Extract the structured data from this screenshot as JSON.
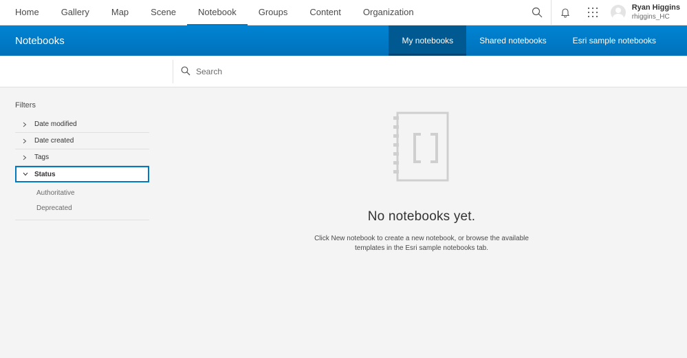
{
  "topnav": {
    "links": [
      {
        "label": "Home"
      },
      {
        "label": "Gallery"
      },
      {
        "label": "Map"
      },
      {
        "label": "Scene"
      },
      {
        "label": "Notebook"
      },
      {
        "label": "Groups"
      },
      {
        "label": "Content"
      },
      {
        "label": "Organization"
      }
    ],
    "active": "Notebook",
    "icons": [
      "search-icon",
      "bell-icon",
      "app-launcher-icon"
    ],
    "user": {
      "name": "Ryan Higgins",
      "username": "rhiggins_HC"
    }
  },
  "header": {
    "title": "Notebooks",
    "tabs": [
      {
        "label": "My notebooks"
      },
      {
        "label": "Shared notebooks"
      },
      {
        "label": "Esri sample notebooks"
      }
    ],
    "active_tab": "My notebooks"
  },
  "search": {
    "placeholder": "Search"
  },
  "filters": {
    "title": "Filters",
    "items": [
      {
        "label": "Date modified"
      },
      {
        "label": "Date created"
      },
      {
        "label": "Tags"
      },
      {
        "label": "Status"
      }
    ],
    "status_options": [
      {
        "label": "Authoritative"
      },
      {
        "label": "Deprecated"
      }
    ]
  },
  "empty_state": {
    "title": "No notebooks yet.",
    "message": "Click New notebook to create a new notebook, or browse the available templates in the Esri sample notebooks tab."
  },
  "colors": {
    "brand_blue": "#0079c1",
    "header_blue": "#007ac2",
    "active_tab": "#005a91"
  }
}
